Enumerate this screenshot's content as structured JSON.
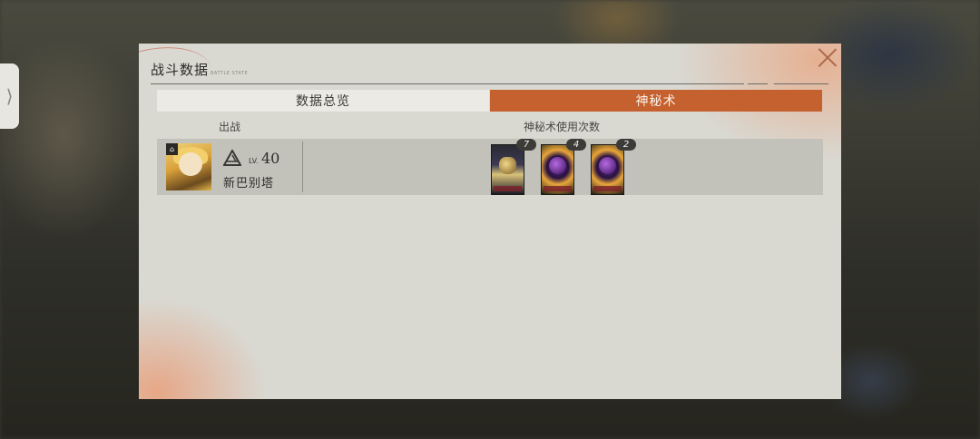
{
  "panel": {
    "title": "战斗数据",
    "subtitle": "BATTLE STATE",
    "close_icon": "close-icon"
  },
  "tabs": [
    {
      "label": "数据总览",
      "active": false
    },
    {
      "label": "神秘术",
      "active": true
    }
  ],
  "columns": {
    "deployed": "出战",
    "mystic_uses": "神秘术使用次数"
  },
  "character": {
    "level_prefix": "LV.",
    "level": "40",
    "name": "新巴别塔",
    "rank_icon": "triangle-rank-icon",
    "portrait": "character-portrait"
  },
  "cards": [
    {
      "icon": "mystic-card-portrait",
      "count": "7"
    },
    {
      "icon": "mystic-card-orb",
      "count": "4"
    },
    {
      "icon": "mystic-card-orb",
      "count": "2"
    }
  ],
  "colors": {
    "accent": "#c5612f",
    "panel_bg": "#d9d8d1",
    "row_bg": "#c2c1ba"
  }
}
